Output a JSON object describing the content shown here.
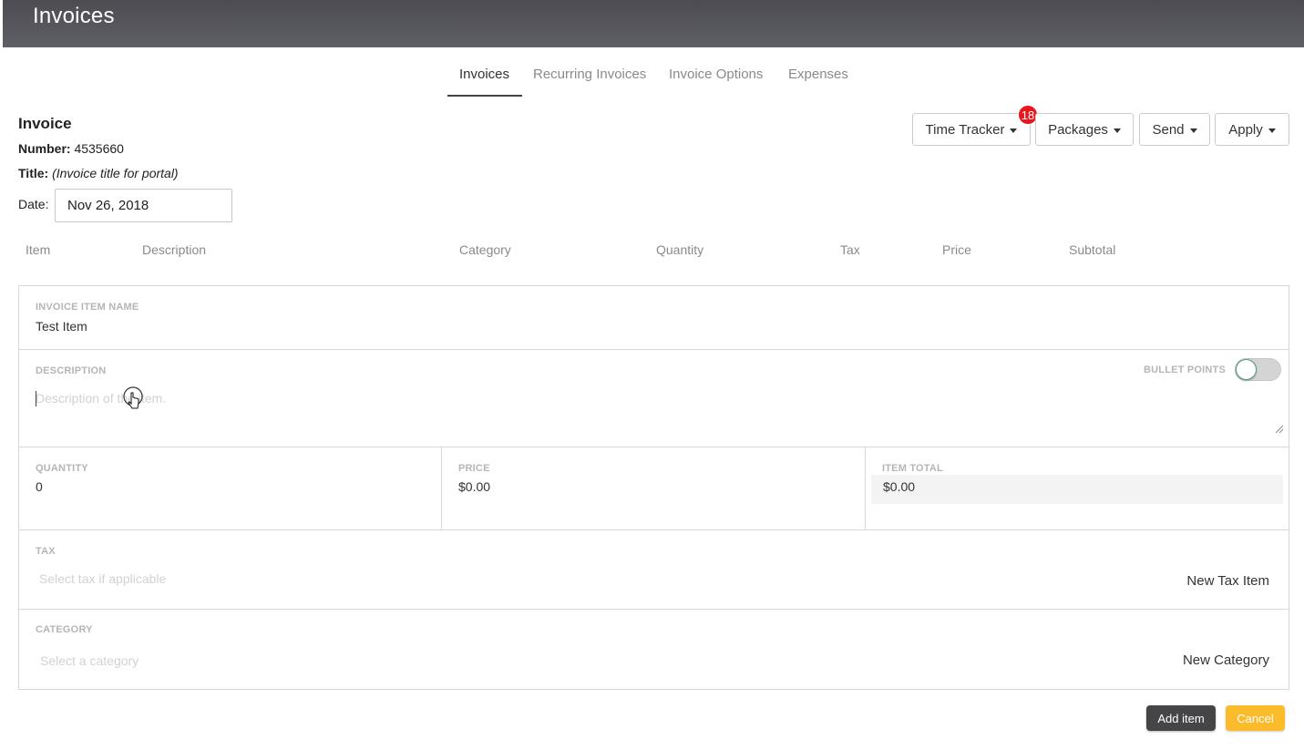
{
  "header": {
    "title": "Invoices"
  },
  "tabs": [
    {
      "label": "Invoices",
      "active": true
    },
    {
      "label": "Recurring Invoices",
      "active": false
    },
    {
      "label": "Invoice Options",
      "active": false
    },
    {
      "label": "Expenses",
      "active": false
    }
  ],
  "invoice": {
    "heading": "Invoice",
    "number_label": "Number:",
    "number": "4535660",
    "title_label": "Title:",
    "title_placeholder": "(Invoice title for portal)",
    "date_label": "Date:",
    "date_value": "Nov 26, 2018"
  },
  "toolbar": {
    "time_tracker": "Time Tracker",
    "time_tracker_badge": "18",
    "packages": "Packages",
    "send": "Send",
    "apply": "Apply"
  },
  "columns": [
    "Item",
    "Description",
    "Category",
    "Quantity",
    "Tax",
    "Price",
    "Subtotal"
  ],
  "form": {
    "item_name_label": "INVOICE ITEM NAME",
    "item_name_value": "Test Item",
    "description_label": "DESCRIPTION",
    "description_placeholder": "Description of the item.",
    "bullet_points_label": "BULLET POINTS",
    "bullet_points_on": false,
    "quantity_label": "QUANTITY",
    "quantity_value": "0",
    "price_label": "PRICE",
    "price_value": "$0.00",
    "item_total_label": "ITEM TOTAL",
    "item_total_value": "$0.00",
    "tax_label": "TAX",
    "tax_placeholder": "Select tax if applicable",
    "new_tax_item": "New Tax Item",
    "category_label": "CATEGORY",
    "category_placeholder": "Select a category",
    "new_category": "New Category"
  },
  "actions": {
    "add_item": "Add item",
    "cancel": "Cancel"
  },
  "colors": {
    "header_bg": "#55555b",
    "badge": "#e8171e",
    "cancel_button": "#fbbb2b",
    "add_button": "#454548"
  }
}
